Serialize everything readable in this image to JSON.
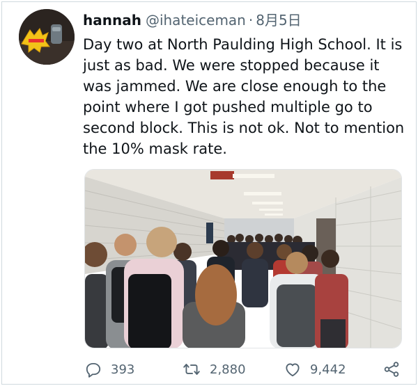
{
  "tweet": {
    "display_name": "hannah",
    "handle": "@ihateiceman",
    "separator": "·",
    "date": "8月5日",
    "text": "Day two at North Paulding High School. It is just as bad. We were stopped because it was jammed. We are close enough to the point where I got pushed multiple go to second block. This is not ok. Not to mention the 10% mask rate.",
    "avatar_icon": "avatar-sticker-icon",
    "photo_description_icon": "crowded-hallway-photo"
  },
  "actions": {
    "reply_count": "393",
    "retweet_count": "2,880",
    "like_count": "9,442",
    "icons": [
      "reply-icon",
      "retweet-icon",
      "like-icon",
      "share-icon"
    ]
  },
  "colors": {
    "text_primary": "#0f1419",
    "text_secondary": "#536471",
    "border": "#cfd9de"
  }
}
